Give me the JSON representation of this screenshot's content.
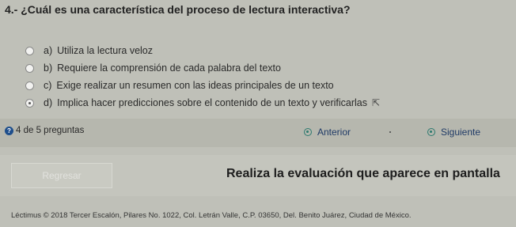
{
  "question": {
    "title": "4.- ¿Cuál es una característica del proceso de lectura interactiva?"
  },
  "options": [
    {
      "letter": "a)",
      "text": "Utiliza la lectura veloz",
      "selected": false
    },
    {
      "letter": "b)",
      "text": "Requiere la comprensión de cada palabra del texto",
      "selected": false
    },
    {
      "letter": "c)",
      "text": "Exige realizar un resumen con las ideas principales de un texto",
      "selected": false
    },
    {
      "letter": "d)",
      "text": "Implica hacer predicciones sobre el contenido de un texto y verificarlas",
      "selected": true
    }
  ],
  "progress": {
    "icon": "question-icon",
    "label": "4 de 5 preguntas",
    "current": 4,
    "total": 5
  },
  "nav": {
    "previous_label": "Anterior",
    "next_label": "Siguiente",
    "accent": "#2c7a6f"
  },
  "bottom": {
    "back_label": "Regresar",
    "instruction": "Realiza la evaluación que aparece en pantalla"
  },
  "footer": {
    "text": "Léctimus © 2018 Tercer Escalón, Pilares No. 1022, Col. Letrán Valle, C.P. 03650, Del. Benito Juárez, Ciudad de México."
  }
}
